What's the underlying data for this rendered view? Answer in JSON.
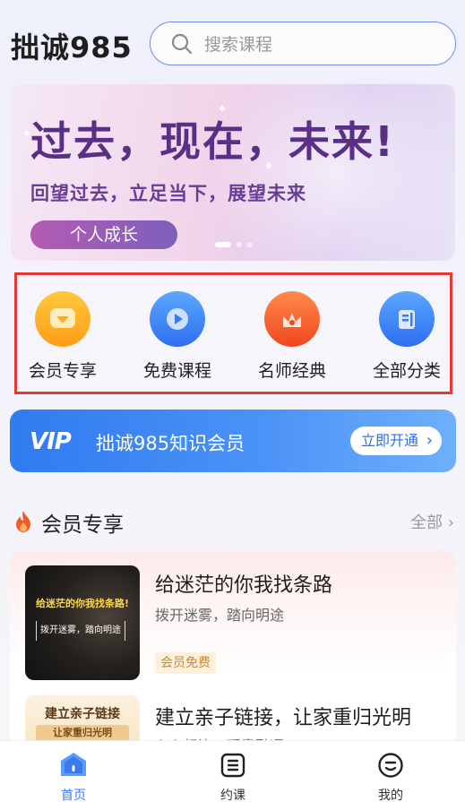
{
  "header": {
    "app_title": "拙诚985",
    "search_placeholder": "搜索课程"
  },
  "banner": {
    "title": "过去，现在，未来!",
    "subtitle": "回望过去，立足当下，展望未来",
    "tag": "个人成长",
    "slides_total": 3,
    "active_slide": 1
  },
  "quick_nav": [
    {
      "label": "会员专享",
      "icon": "diamond-icon"
    },
    {
      "label": "免费课程",
      "icon": "play-icon"
    },
    {
      "label": "名师经典",
      "icon": "crown-icon"
    },
    {
      "label": "全部分类",
      "icon": "book-icon"
    }
  ],
  "vip": {
    "logo": "VIP",
    "text": "拙诚985知识会员",
    "button": "立即开通"
  },
  "section": {
    "title": "会员专享",
    "more": "全部",
    "icon": "fire-icon"
  },
  "courses": [
    {
      "title": "给迷茫的你我找条路",
      "subtitle": "拨开迷雾，踏向明途",
      "badge": "会员免费",
      "thumb_title": "给迷茫的你我找条路!",
      "thumb_sub": "拨开迷雾，踏向明途"
    },
    {
      "title": "建立亲子链接，让家重归光明",
      "subtitle": "心心相连，暖意融通",
      "thumb_line1": "建立亲子链接",
      "thumb_line2": "让家重归光明"
    }
  ],
  "tabbar": [
    {
      "label": "首页",
      "icon": "home-icon",
      "active": true
    },
    {
      "label": "约课",
      "icon": "schedule-icon",
      "active": false
    },
    {
      "label": "我的",
      "icon": "profile-icon",
      "active": false
    }
  ],
  "colors": {
    "accent_blue": "#3a7af0",
    "highlight_red": "#e53935",
    "banner_purple": "#5a2f86"
  }
}
